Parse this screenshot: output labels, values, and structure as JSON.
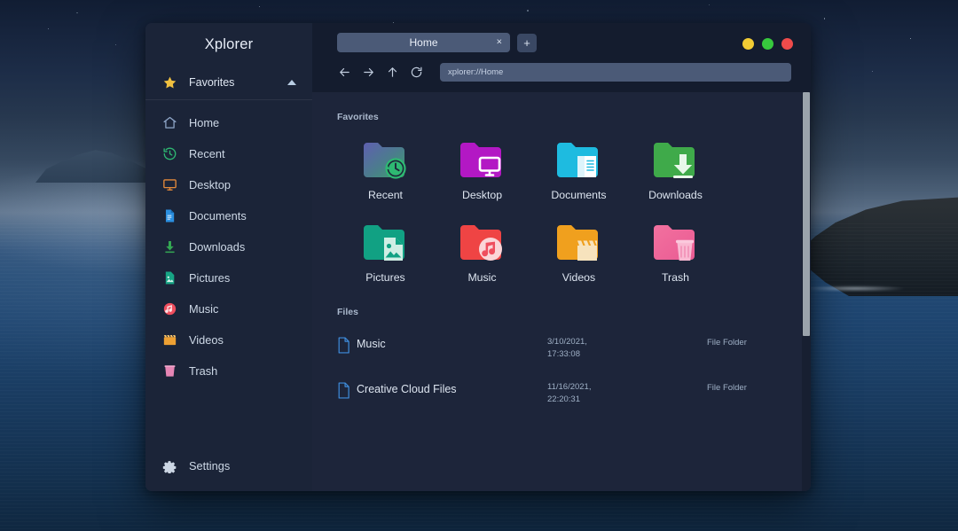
{
  "app": {
    "title": "Xplorer"
  },
  "window_controls": [
    {
      "name": "minimize",
      "color": "#f2cc34"
    },
    {
      "name": "maximize",
      "color": "#37c93d"
    },
    {
      "name": "close",
      "color": "#ef4b4b"
    }
  ],
  "tabs": {
    "items": [
      {
        "label": "Home",
        "close_label": "×",
        "active": true
      }
    ],
    "new_tab_label": "+"
  },
  "toolbar": {
    "back_icon": "arrow-left-icon",
    "forward_icon": "arrow-right-icon",
    "up_icon": "arrow-up-icon",
    "reload_icon": "reload-icon",
    "address_value": "xplorer://Home",
    "address_placeholder": "xplorer://Home"
  },
  "sidebar": {
    "favorites_header": {
      "label": "Favorites",
      "icon": "star-icon",
      "collapse_icon": "triangle-up-icon"
    },
    "items": [
      {
        "label": "Home",
        "icon": "home-icon",
        "color": "#8fa6c8"
      },
      {
        "label": "Recent",
        "icon": "history-icon",
        "color": "#2eb872"
      },
      {
        "label": "Desktop",
        "icon": "monitor-icon",
        "color": "#e3893a"
      },
      {
        "label": "Documents",
        "icon": "document-icon",
        "color": "#2b8fe0"
      },
      {
        "label": "Downloads",
        "icon": "download-icon",
        "color": "#34a853"
      },
      {
        "label": "Pictures",
        "icon": "image-icon",
        "color": "#17a585"
      },
      {
        "label": "Music",
        "icon": "music-icon",
        "color": "#ef4e5e"
      },
      {
        "label": "Videos",
        "icon": "clapper-icon",
        "color": "#eda033"
      },
      {
        "label": "Trash",
        "icon": "trash-icon",
        "color": "#e686b5"
      }
    ],
    "settings": {
      "label": "Settings",
      "icon": "gear-icon"
    }
  },
  "main": {
    "favorites_section_title": "Favorites",
    "favorites": [
      {
        "label": "Recent",
        "icon": "folder-recent-icon",
        "folder_color": "#5a5fa8",
        "accent": "#2eb872"
      },
      {
        "label": "Desktop",
        "icon": "folder-desktop-icon",
        "folder_color": "#b318c4",
        "accent": "#ffffff"
      },
      {
        "label": "Documents",
        "icon": "folder-documents-icon",
        "folder_color": "#1ebbe0",
        "accent": "#ffffff"
      },
      {
        "label": "Downloads",
        "icon": "folder-downloads-icon",
        "folder_color": "#3faa4a",
        "accent": "#ffffff"
      },
      {
        "label": "Pictures",
        "icon": "folder-pictures-icon",
        "folder_color": "#11a183",
        "accent": "#cfeee4"
      },
      {
        "label": "Music",
        "icon": "folder-music-icon",
        "folder_color": "#ef4444",
        "accent": "#fbd5d8"
      },
      {
        "label": "Videos",
        "icon": "folder-videos-icon",
        "folder_color": "#f0a01e",
        "accent": "#f7e3bd"
      },
      {
        "label": "Trash",
        "icon": "folder-trash-icon",
        "folder_color": "#f0699f",
        "accent": "#f9b9d2"
      }
    ],
    "files_section_title": "Files",
    "files": [
      {
        "name": "Music",
        "date": "3/10/2021,\n17:33:08",
        "type": "File Folder",
        "icon": "file-icon"
      },
      {
        "name": "Creative Cloud Files",
        "date": "11/16/2021,\n22:20:31",
        "type": "File Folder",
        "icon": "file-icon"
      }
    ]
  },
  "scrollbar": {
    "thumb_position_percent": 0,
    "thumb_size_percent": 61
  },
  "theme": {
    "window_bg": "#1d253a",
    "sidebar_bg": "#1b2438",
    "topbar_bg": "#141c2e",
    "tab_active_bg": "#4b5a77",
    "text_primary": "#dde5f0",
    "text_muted": "#9fb0c6"
  }
}
